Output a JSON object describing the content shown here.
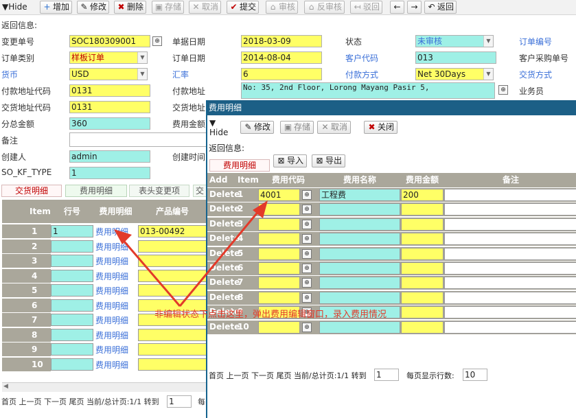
{
  "toolbar": {
    "hide": "Hide",
    "add": "增加",
    "edit": "修改",
    "delete": "删除",
    "save": "存储",
    "cancel": "取消",
    "submit": "提交",
    "audit": "审核",
    "unaudit": "反审核",
    "reject": "驳回",
    "back": "返回"
  },
  "return_info": "返回信息:",
  "form": {
    "change_no_label": "变更单号",
    "change_no": "SOC180309001",
    "doc_date_label": "单据日期",
    "doc_date": "2018-03-09",
    "status_label": "状态",
    "status": "未审核",
    "order_no_label": "订单编号",
    "order_type_label": "订单类别",
    "order_type": "样板订单",
    "order_date_label": "订单日期",
    "order_date": "2014-08-04",
    "customer_code_label": "客户代码",
    "customer_code": "013",
    "customer_po_label": "客户采购单号",
    "currency_label": "货币",
    "currency": "USD",
    "rate_label": "汇率",
    "rate": "6",
    "pay_method_label": "付款方式",
    "pay_method": "Net 30Days",
    "delivery_method_label": "交货方式",
    "pay_addr_code_label": "付款地址代码",
    "pay_addr_code": "0131",
    "pay_addr_label": "付款地址",
    "pay_addr": "No: 35, 2nd Floor, Lorong Mayang Pasir 5,",
    "salesman_label": "业务员",
    "deliv_addr_code_label": "交货地址代码",
    "deliv_addr_code": "0131",
    "deliv_addr_label": "交货地址",
    "subtotal_label": "分总金额",
    "subtotal": "360",
    "fee_amount_label": "费用金额",
    "remark_label": "备注",
    "creator_label": "创建人",
    "creator": "admin",
    "create_time_label": "创建时间",
    "so_kf_type_label": "SO_KF_TYPE",
    "so_kf_type": "1"
  },
  "tabs": [
    "交货明细",
    "费用明细",
    "表头变更项",
    "交"
  ],
  "main_table": {
    "headers": [
      "Item",
      "行号",
      "费用明细",
      "产品编号"
    ],
    "rows": [
      {
        "item": "1",
        "line": "1",
        "fee": "费用明细",
        "product": "013-00492"
      },
      {
        "item": "2",
        "line": "",
        "fee": "费用明细",
        "product": ""
      },
      {
        "item": "3",
        "line": "",
        "fee": "费用明细",
        "product": ""
      },
      {
        "item": "4",
        "line": "",
        "fee": "费用明细",
        "product": ""
      },
      {
        "item": "5",
        "line": "",
        "fee": "费用明细",
        "product": ""
      },
      {
        "item": "6",
        "line": "",
        "fee": "费用明细",
        "product": ""
      },
      {
        "item": "7",
        "line": "",
        "fee": "费用明细",
        "product": ""
      },
      {
        "item": "8",
        "line": "",
        "fee": "费用明细",
        "product": ""
      },
      {
        "item": "9",
        "line": "",
        "fee": "费用明细",
        "product": ""
      },
      {
        "item": "10",
        "line": "",
        "fee": "费用明细",
        "product": ""
      }
    ]
  },
  "main_pager": {
    "text": "首页 上一页 下一页 尾页 当前/总计页:1/1 转到",
    "goto": "1",
    "rows_label": "每"
  },
  "popup": {
    "title": "费用明细",
    "hide": "Hide",
    "edit": "修改",
    "save": "存储",
    "cancel": "取消",
    "close": "关闭",
    "return_info": "返回信息:",
    "tab": "费用明细",
    "import": "导入",
    "export": "导出",
    "headers": [
      "Add",
      "Item",
      "费用代码",
      "费用名称",
      "费用金额",
      "备注"
    ],
    "delete_label": "Delete",
    "rows": [
      {
        "item": "1",
        "code": "4001",
        "name": "工程费",
        "amount": "200"
      },
      {
        "item": "2",
        "code": "",
        "name": "",
        "amount": ""
      },
      {
        "item": "3",
        "code": "",
        "name": "",
        "amount": ""
      },
      {
        "item": "4",
        "code": "",
        "name": "",
        "amount": ""
      },
      {
        "item": "5",
        "code": "",
        "name": "",
        "amount": ""
      },
      {
        "item": "6",
        "code": "",
        "name": "",
        "amount": ""
      },
      {
        "item": "7",
        "code": "",
        "name": "",
        "amount": ""
      },
      {
        "item": "8",
        "code": "",
        "name": "",
        "amount": ""
      },
      {
        "item": "9",
        "code": "",
        "name": "",
        "amount": ""
      },
      {
        "item": "10",
        "code": "",
        "name": "",
        "amount": ""
      }
    ],
    "pager_text": "首页 上一页 下一页 尾页 当前/总计页:1/1 转到",
    "pager_goto": "1",
    "rows_per_page_label": "每页显示行数:",
    "rows_per_page": "10"
  },
  "annotation": "非编辑状态下点击这里，弹出费用编辑窗口，录入费用情况",
  "colors": {
    "yellow": "#ffff66",
    "cyan": "#9ff0e6",
    "header": "#aaa79b",
    "popup_title": "#1c5f86",
    "annotation": "#e23a2a"
  }
}
